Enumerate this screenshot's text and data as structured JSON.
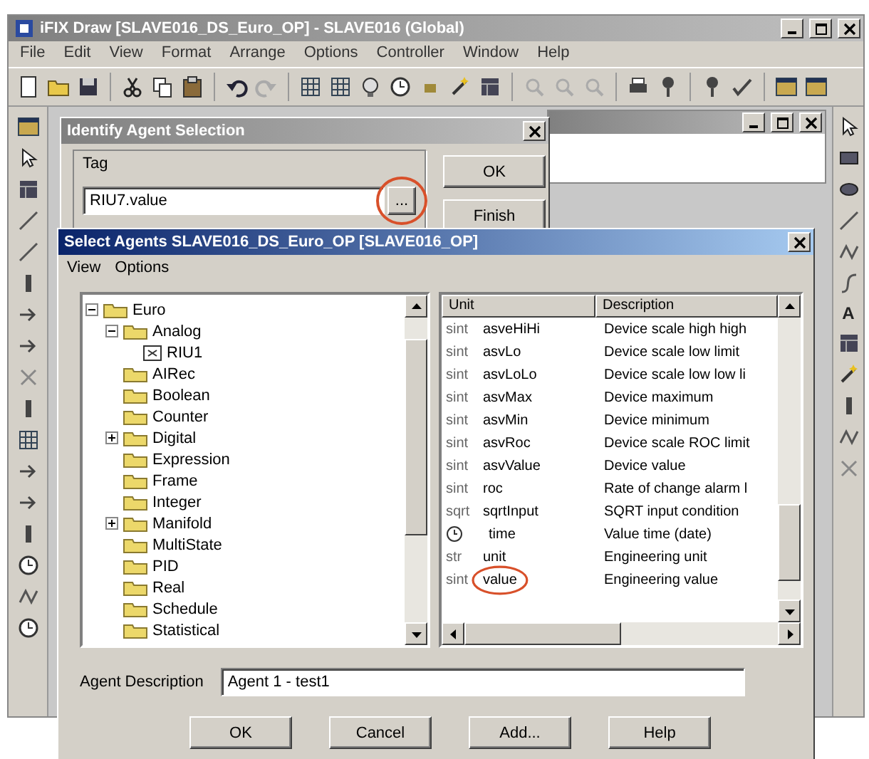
{
  "app_window": {
    "title": "iFIX Draw [SLAVE016_DS_Euro_OP] - SLAVE016 (Global)",
    "menu": [
      "File",
      "Edit",
      "View",
      "Format",
      "Arrange",
      "Options",
      "Controller",
      "Window",
      "Help"
    ],
    "text_tool": "A"
  },
  "tag_dialog": {
    "title": "Identify Agent Selection",
    "tag_label": "Tag",
    "tag_value": "RIU7.value",
    "browse_label": "...",
    "browse_highlighted": true,
    "buttons": [
      "OK",
      "Finish"
    ]
  },
  "agent_dialog": {
    "title": "Select Agents SLAVE016_DS_Euro_OP [SLAVE016_OP]",
    "menu": [
      "View",
      "Options"
    ],
    "tree": [
      {
        "label": "Euro",
        "kind": "group",
        "expanded": true,
        "children": [
          {
            "label": "Analog",
            "kind": "group",
            "expanded": true,
            "children": [
              {
                "label": "RIU1",
                "kind": "tag"
              }
            ]
          },
          {
            "label": "AIRec",
            "kind": "folder"
          },
          {
            "label": "Boolean",
            "kind": "folder"
          },
          {
            "label": "Counter",
            "kind": "folder"
          },
          {
            "label": "Digital",
            "kind": "group",
            "expanded": false
          },
          {
            "label": "Expression",
            "kind": "folder"
          },
          {
            "label": "Frame",
            "kind": "folder"
          },
          {
            "label": "Integer",
            "kind": "folder"
          },
          {
            "label": "Manifold",
            "kind": "group",
            "expanded": false
          },
          {
            "label": "MultiState",
            "kind": "folder"
          },
          {
            "label": "PID",
            "kind": "folder"
          },
          {
            "label": "Real",
            "kind": "folder"
          },
          {
            "label": "Schedule",
            "kind": "folder"
          },
          {
            "label": "Statistical",
            "kind": "folder"
          }
        ]
      }
    ],
    "list": {
      "columns": [
        "Unit",
        "Description"
      ],
      "rows": [
        {
          "kind": "text",
          "type": "sint",
          "name": "asveHiHi",
          "description": "Device scale high high",
          "highlighted": false
        },
        {
          "kind": "text",
          "type": "sint",
          "name": "asvLo",
          "description": "Device scale low limit",
          "highlighted": false
        },
        {
          "kind": "text",
          "type": "sint",
          "name": "asvLoLo",
          "description": "Device scale low low li",
          "highlighted": false
        },
        {
          "kind": "text",
          "type": "sint",
          "name": "asvMax",
          "description": "Device maximum",
          "highlighted": false
        },
        {
          "kind": "text",
          "type": "sint",
          "name": "asvMin",
          "description": "Device minimum",
          "highlighted": false
        },
        {
          "kind": "text",
          "type": "sint",
          "name": "asvRoc",
          "description": "Device scale ROC limit",
          "highlighted": false
        },
        {
          "kind": "text",
          "type": "sint",
          "name": "asvValue",
          "description": "Device value",
          "highlighted": false
        },
        {
          "kind": "text",
          "type": "sint",
          "name": "roc",
          "description": "Rate of change alarm l",
          "highlighted": false
        },
        {
          "kind": "text",
          "type": "sqrt",
          "name": "sqrtInput",
          "description": "SQRT input condition",
          "highlighted": false
        },
        {
          "kind": "clock",
          "name": "time",
          "description": "Value time (date)",
          "highlighted": false
        },
        {
          "kind": "text",
          "type": "str",
          "name": "unit",
          "description": "Engineering unit",
          "highlighted": false
        },
        {
          "kind": "text",
          "type": "sint",
          "name": "value",
          "description": "Engineering value",
          "highlighted": true
        }
      ]
    },
    "agent_description": {
      "label": "Agent Description",
      "value": "Agent 1 - test1"
    },
    "buttons": [
      "OK",
      "Cancel",
      "Add...",
      "Help"
    ]
  }
}
